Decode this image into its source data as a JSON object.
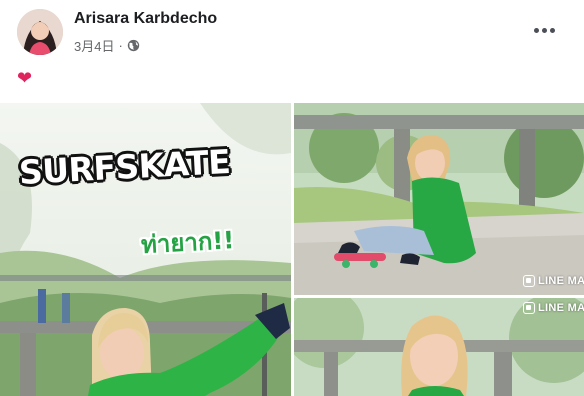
{
  "post": {
    "author_name": "Arisara Karbdecho",
    "date": "3月4日",
    "separator": "·",
    "privacy_icon": "globe-icon",
    "reaction_emoji": "❤",
    "more_icon": "ellipsis-icon"
  },
  "photos": {
    "main": {
      "title": "SURFSKATE",
      "caption": "ท่ายาก!!"
    },
    "top_right": {
      "watermark": "LINE MAN"
    },
    "bottom_right": {
      "watermark": "LINE MAN"
    }
  },
  "colors": {
    "brand_green": "#25a244",
    "heart_red": "#e0245e",
    "author_text": "#1c1e21",
    "meta_text": "#65676b"
  }
}
